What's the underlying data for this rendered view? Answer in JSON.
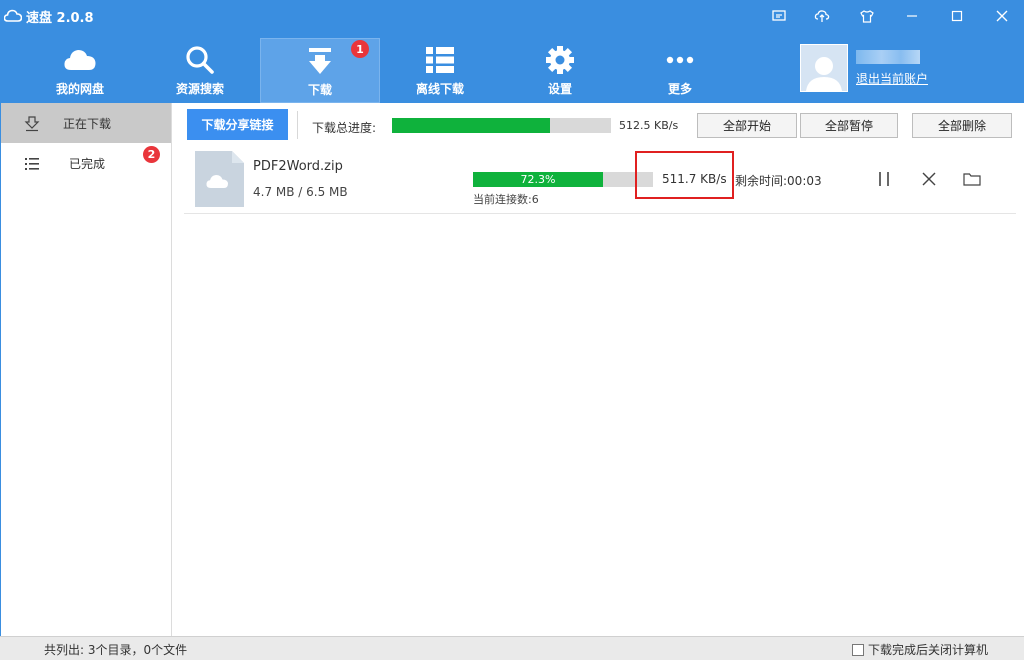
{
  "app": {
    "title": "速盘 2.0.8"
  },
  "window_controls": [
    "feedback-icon",
    "upload-icon",
    "shirt-icon",
    "minimize-icon",
    "maximize-icon",
    "close-icon"
  ],
  "nav": {
    "items": [
      {
        "label": "我的网盘",
        "icon": "cloud-icon"
      },
      {
        "label": "资源搜索",
        "icon": "search-icon"
      },
      {
        "label": "下载",
        "icon": "download-arrow-icon",
        "badge": "1",
        "active": true
      },
      {
        "label": "离线下载",
        "icon": "list-icon"
      },
      {
        "label": "设置",
        "icon": "gear-icon"
      },
      {
        "label": "更多",
        "icon": "more-dots-icon"
      }
    ]
  },
  "user": {
    "logout": "退出当前账户"
  },
  "sidebar": {
    "items": [
      {
        "label": "正在下载",
        "icon": "download-tray-icon",
        "active": true
      },
      {
        "label": "已完成",
        "icon": "list-icon",
        "badge": "2"
      }
    ]
  },
  "toolbar": {
    "share_button": "下载分享链接",
    "total_label": "下载总进度:",
    "total_progress": 0.72,
    "total_speed": "512.5 KB/s",
    "start_all": "全部开始",
    "pause_all": "全部暂停",
    "delete_all": "全部删除"
  },
  "downloads": [
    {
      "name": "PDF2Word.zip",
      "size": "4.7 MB / 6.5 MB",
      "progress_label": "72.3%",
      "progress": 0.723,
      "connections": "当前连接数:6",
      "speed": "511.7 KB/s",
      "remaining": "剩余时间:00:03"
    }
  ],
  "status": {
    "summary": "共列出: 3个目录，0个文件",
    "shutdown_label": "下载完成后关闭计算机"
  },
  "colors": {
    "header": "#3a8ee0",
    "progress": "#0fb23c",
    "badge": "#e9353b",
    "highlight": "#e02020"
  }
}
